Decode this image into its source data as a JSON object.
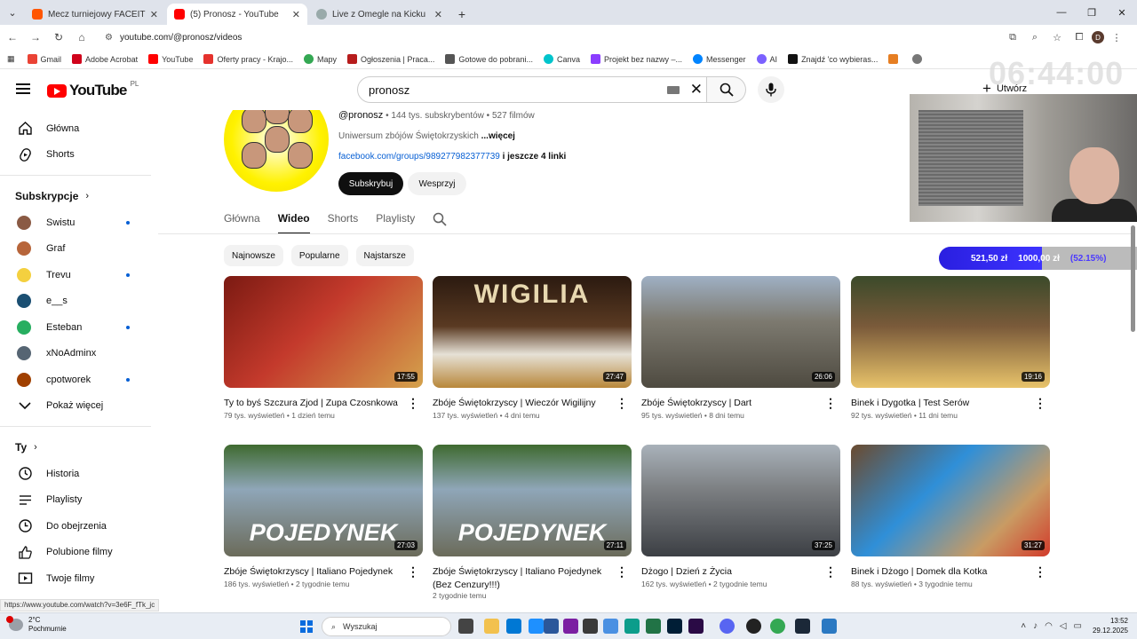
{
  "browser": {
    "tabs": [
      {
        "title": "Mecz turniejowy FACEIT - FACEIT",
        "active": false,
        "favicon_color": "#ff5500"
      },
      {
        "title": "(5) Pronosz - YouTube",
        "active": true,
        "favicon_color": "#ff0000"
      },
      {
        "title": "Live z Omegle na Kicku",
        "active": false,
        "favicon_color": "#53fc18"
      }
    ],
    "new_tab": "+",
    "url": "youtube.com/@pronosz/videos",
    "profile_initial": "D",
    "bookmarks": [
      {
        "label": "Gmail",
        "color": "#ea4335"
      },
      {
        "label": "Adobe Acrobat",
        "color": "#d0021b"
      },
      {
        "label": "YouTube",
        "color": "#ff0000"
      },
      {
        "label": "Oferty pracy - Krajo...",
        "color": "#e5322d"
      },
      {
        "label": "Mapy",
        "color": "#34a853"
      },
      {
        "label": "Ogłoszenia | Praca...",
        "color": "#b71c1c"
      },
      {
        "label": "Gotowe do pobrani...",
        "color": "#555555"
      },
      {
        "label": "Canva",
        "color": "#00c4cc"
      },
      {
        "label": "Projekt bez nazwy –...",
        "color": "#8b3dff"
      },
      {
        "label": "Messenger",
        "color": "#0084ff"
      },
      {
        "label": "AI",
        "color": "#7b61ff"
      },
      {
        "label": "Znajdź 'co wybieras...",
        "color": "#111111"
      }
    ]
  },
  "youtube": {
    "logo_text": "YouTube",
    "region": "PL",
    "search_value": "pronosz",
    "create_label": "Utwórz",
    "notification_count": "5",
    "overlay_clock": "06:44:00"
  },
  "sidebar": {
    "main": [
      {
        "label": "Główna",
        "icon": "home-icon"
      },
      {
        "label": "Shorts",
        "icon": "shorts-icon"
      }
    ],
    "subs_heading": "Subskrypcje",
    "subscriptions": [
      {
        "label": "Swistu",
        "color": "#8a5a44",
        "new": true
      },
      {
        "label": "Graf",
        "color": "#b7653a",
        "new": false
      },
      {
        "label": "Trevu",
        "color": "#f4d03f",
        "new": true
      },
      {
        "label": "e__s",
        "color": "#1b4f72",
        "new": false
      },
      {
        "label": "Esteban",
        "color": "#27ae60",
        "new": true
      },
      {
        "label": "xNoAdminx",
        "color": "#566573",
        "new": false
      },
      {
        "label": "cpotworek",
        "color": "#a04000",
        "new": true
      }
    ],
    "show_more": "Pokaż więcej",
    "you_heading": "Ty",
    "you_items": [
      {
        "label": "Historia",
        "icon": "history-icon"
      },
      {
        "label": "Playlisty",
        "icon": "playlist-icon"
      },
      {
        "label": "Do obejrzenia",
        "icon": "watch-later-icon"
      },
      {
        "label": "Polubione filmy",
        "icon": "like-icon"
      },
      {
        "label": "Twoje filmy",
        "icon": "your-videos-icon"
      }
    ]
  },
  "channel": {
    "handle": "@pronosz",
    "subscribers": "144 tys. subskrybentów",
    "video_count": "527 filmów",
    "separator": "•",
    "description": "Uniwersum zbójów Świętokrzyskich",
    "more": "...więcej",
    "link": "facebook.com/groups/989277982377739",
    "more_links": "i jeszcze 4 linki",
    "subscribe": "Subskrybuj",
    "support": "Wesprzyj",
    "tabs": [
      "Główna",
      "Wideo",
      "Shorts",
      "Playlisty"
    ],
    "active_tab": 1,
    "chips": [
      "Najnowsze",
      "Popularne",
      "Najstarsze"
    ]
  },
  "videos": [
    {
      "title": "Ty to byś Szczura Zjod | Zupa Czosnkowa",
      "views": "79 tys. wyświetleń",
      "age": "1 dzień temu",
      "duration": "17:55",
      "bg": "#7b1a12",
      "bg2": "#d4a24c",
      "overlay": ""
    },
    {
      "title": "Zbóje Świętokrzyscy | Wieczór Wigilijny",
      "views": "137 tys. wyświetleń",
      "age": "4 dni temu",
      "duration": "27:47",
      "bg": "#2b1a10",
      "bg2": "#b8873a",
      "overlay": "WIGILIA"
    },
    {
      "title": "Zbóje Świętokrzyscy | Dart",
      "views": "95 tys. wyświetleń",
      "age": "8 dni temu",
      "duration": "26:06",
      "bg": "#6e6a5e",
      "bg2": "#9fb0c4",
      "overlay": ""
    },
    {
      "title": "Binek i Dygotka | Test Serów",
      "views": "92 tys. wyświetleń",
      "age": "11 dni temu",
      "duration": "19:16",
      "bg": "#3b4a2a",
      "bg2": "#e8c36a",
      "overlay": ""
    },
    {
      "title": "Zbóje Świętokrzyscy | Italiano Pojedynek",
      "views": "186 tys. wyświetleń",
      "age": "2 tygodnie temu",
      "duration": "27:03",
      "bg": "#4d6b3c",
      "bg2": "#8fa6b8",
      "overlay": "POJEDYNEK"
    },
    {
      "title": "Zbóje Świętokrzyscy | Italiano Pojedynek (Bez Cenzury!!!)",
      "views": "",
      "age": "2 tygodnie temu",
      "duration": "27:11",
      "bg": "#4d6b3c",
      "bg2": "#8fa6b8",
      "overlay": "POJEDYNEK"
    },
    {
      "title": "Dżogo | Dzień z Życia",
      "views": "162 tys. wyświetleń",
      "age": "2 tygodnie temu",
      "duration": "37:25",
      "bg": "#55585c",
      "bg2": "#a9b2ba",
      "overlay": ""
    },
    {
      "title": "Binek i Dżogo | Domek dla Kotka",
      "views": "88 tys. wyświetleń",
      "age": "3 tygodnie temu",
      "duration": "31:27",
      "bg": "#6b4a2e",
      "bg2": "#c99b63",
      "overlay": ""
    }
  ],
  "donation": {
    "current": "521,50 zł",
    "goal": "1000,00 zł",
    "percent": "(52.15%)",
    "fraction": 0.5215
  },
  "status_url": "https://www.youtube.com/watch?v=3e6F_fTk_jc",
  "taskbar": {
    "temp": "2°C",
    "condition": "Pochmurnie",
    "search_placeholder": "Wyszukaj",
    "time": "13:52",
    "date": "29.12.2025",
    "weather_badge": "1"
  }
}
